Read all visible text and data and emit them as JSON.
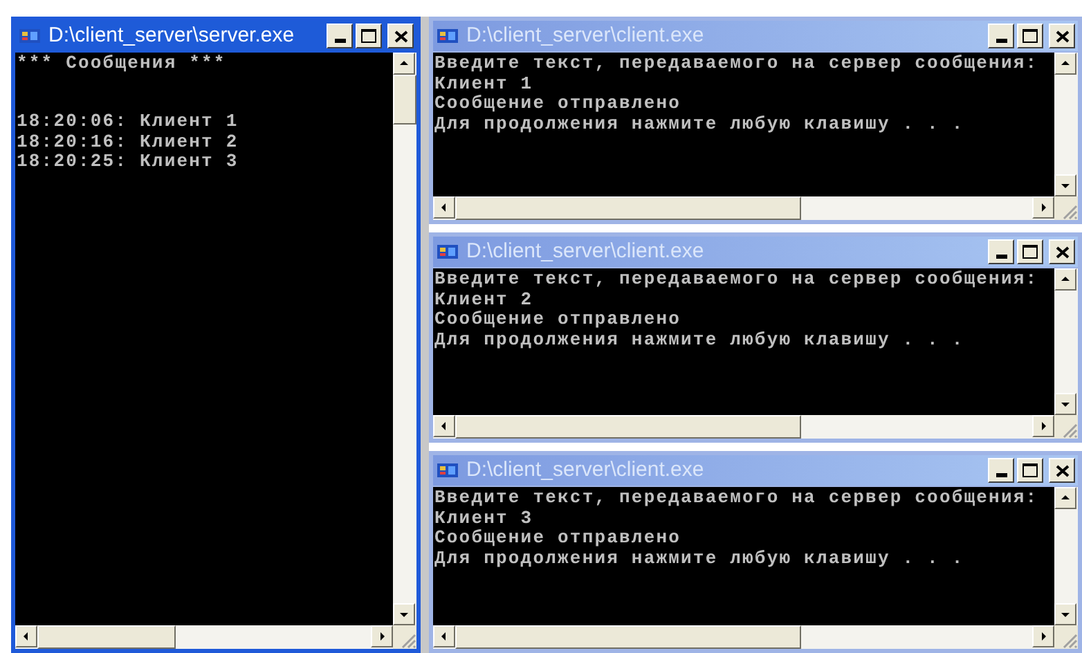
{
  "windows": [
    {
      "kind": "server",
      "title": "D:\\client_server\\server.exe",
      "active": true,
      "header": "*** Сообщения ***",
      "lines": [
        "18:20:06: Клиент 1",
        "18:20:16: Клиент 2",
        "18:20:25: Клиент 3"
      ]
    },
    {
      "kind": "client",
      "title": "D:\\client_server\\client.exe",
      "active": false,
      "lines": [
        "Введите текст, передаваемого на сервер сообщения:",
        "Клиент 1",
        "Сообщение отправлено",
        "Для продолжения нажмите любую клавишу . . ."
      ]
    },
    {
      "kind": "client",
      "title": "D:\\client_server\\client.exe",
      "active": false,
      "lines": [
        "Введите текст, передаваемого на сервер сообщения:",
        "Клиент 2",
        "Сообщение отправлено",
        "Для продолжения нажмите любую клавишу . . ."
      ]
    },
    {
      "kind": "client",
      "title": "D:\\client_server\\client.exe",
      "active": false,
      "lines": [
        "Введите текст, передаваемого на сервер сообщения:",
        "Клиент 3",
        "Сообщение отправлено",
        "Для продолжения нажмите любую клавишу . . ."
      ]
    }
  ]
}
